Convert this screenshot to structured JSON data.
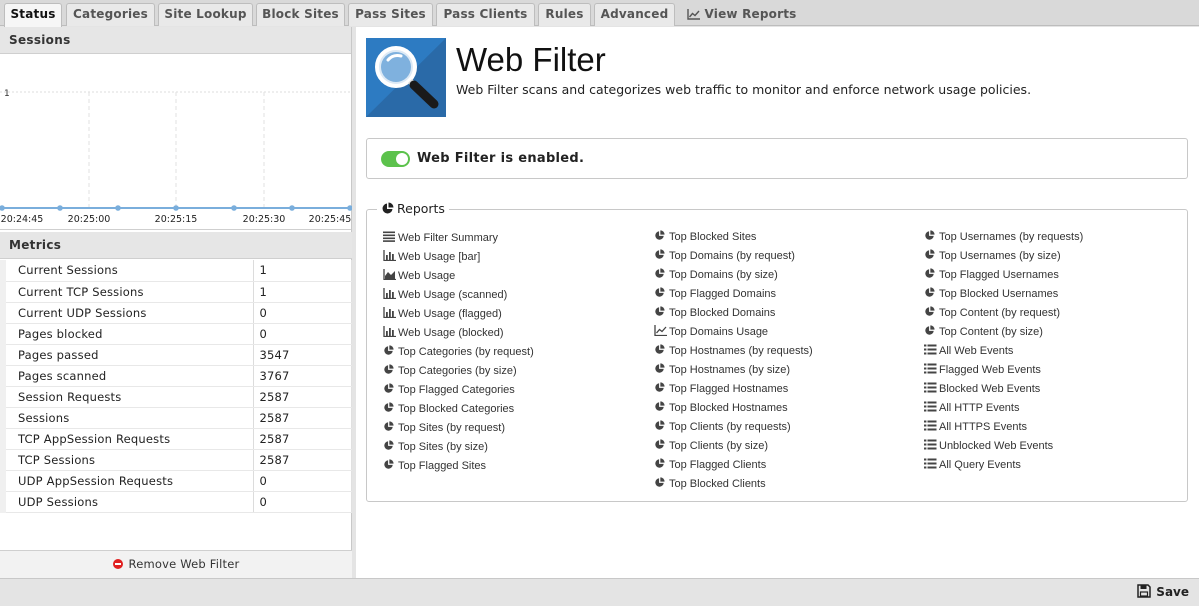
{
  "tabs": [
    {
      "label": "Status",
      "active": true
    },
    {
      "label": "Categories"
    },
    {
      "label": "Site Lookup"
    },
    {
      "label": "Block Sites"
    },
    {
      "label": "Pass Sites"
    },
    {
      "label": "Pass Clients"
    },
    {
      "label": "Rules"
    },
    {
      "label": "Advanced"
    },
    {
      "label": "View Reports",
      "icon": "line-chart-icon"
    }
  ],
  "sessions": {
    "title": "Sessions",
    "chart_data": {
      "type": "line",
      "x": [
        "20:24:45",
        "20:25:00",
        "20:25:15",
        "20:25:30",
        "20:25:45"
      ],
      "values": [
        0,
        0,
        0,
        0,
        0,
        0,
        0
      ],
      "ymax_label": "1",
      "ylim": [
        0,
        1
      ]
    }
  },
  "metrics": {
    "title": "Metrics",
    "rows": [
      {
        "name": "Current Sessions",
        "value": "1"
      },
      {
        "name": "Current TCP Sessions",
        "value": "1"
      },
      {
        "name": "Current UDP Sessions",
        "value": "0"
      },
      {
        "name": "Pages blocked",
        "value": "0"
      },
      {
        "name": "Pages passed",
        "value": "3547"
      },
      {
        "name": "Pages scanned",
        "value": "3767"
      },
      {
        "name": "Session Requests",
        "value": "2587"
      },
      {
        "name": "Sessions",
        "value": "2587"
      },
      {
        "name": "TCP AppSession Requests",
        "value": "2587"
      },
      {
        "name": "TCP Sessions",
        "value": "2587"
      },
      {
        "name": "UDP AppSession Requests",
        "value": "0"
      },
      {
        "name": "UDP Sessions",
        "value": "0"
      }
    ],
    "remove_label": "Remove Web Filter"
  },
  "app": {
    "title": "Web Filter",
    "description": "Web Filter scans and categorizes web traffic to monitor and enforce network usage policies.",
    "status_text": "Web Filter is enabled.",
    "enabled": true
  },
  "reports": {
    "legend": "Reports",
    "columns": [
      [
        {
          "label": "Web Filter Summary",
          "icon": "list-icon"
        },
        {
          "label": "Web Usage [bar]",
          "icon": "bar-chart-icon"
        },
        {
          "label": "Web Usage",
          "icon": "area-chart-icon"
        },
        {
          "label": "Web Usage (scanned)",
          "icon": "bar-chart-icon"
        },
        {
          "label": "Web Usage (flagged)",
          "icon": "bar-chart-icon"
        },
        {
          "label": "Web Usage (blocked)",
          "icon": "bar-chart-icon"
        },
        {
          "label": "Top Categories (by request)",
          "icon": "pie-chart-icon"
        },
        {
          "label": "Top Categories (by size)",
          "icon": "pie-chart-icon"
        },
        {
          "label": "Top Flagged Categories",
          "icon": "pie-chart-icon"
        },
        {
          "label": "Top Blocked Categories",
          "icon": "pie-chart-icon"
        },
        {
          "label": "Top Sites (by request)",
          "icon": "pie-chart-icon"
        },
        {
          "label": "Top Sites (by size)",
          "icon": "pie-chart-icon"
        },
        {
          "label": "Top Flagged Sites",
          "icon": "pie-chart-icon"
        }
      ],
      [
        {
          "label": "Top Blocked Sites",
          "icon": "pie-chart-icon"
        },
        {
          "label": "Top Domains (by request)",
          "icon": "pie-chart-icon"
        },
        {
          "label": "Top Domains (by size)",
          "icon": "pie-chart-icon"
        },
        {
          "label": "Top Flagged Domains",
          "icon": "pie-chart-icon"
        },
        {
          "label": "Top Blocked Domains",
          "icon": "pie-chart-icon"
        },
        {
          "label": "Top Domains Usage",
          "icon": "line-chart-icon"
        },
        {
          "label": "Top Hostnames (by requests)",
          "icon": "pie-chart-icon"
        },
        {
          "label": "Top Hostnames (by size)",
          "icon": "pie-chart-icon"
        },
        {
          "label": "Top Flagged Hostnames",
          "icon": "pie-chart-icon"
        },
        {
          "label": "Top Blocked Hostnames",
          "icon": "pie-chart-icon"
        },
        {
          "label": "Top Clients (by requests)",
          "icon": "pie-chart-icon"
        },
        {
          "label": "Top Clients (by size)",
          "icon": "pie-chart-icon"
        },
        {
          "label": "Top Flagged Clients",
          "icon": "pie-chart-icon"
        },
        {
          "label": "Top Blocked Clients",
          "icon": "pie-chart-icon"
        }
      ],
      [
        {
          "label": "Top Usernames (by requests)",
          "icon": "pie-chart-icon"
        },
        {
          "label": "Top Usernames (by size)",
          "icon": "pie-chart-icon"
        },
        {
          "label": "Top Flagged Usernames",
          "icon": "pie-chart-icon"
        },
        {
          "label": "Top Blocked Usernames",
          "icon": "pie-chart-icon"
        },
        {
          "label": "Top Content (by request)",
          "icon": "pie-chart-icon"
        },
        {
          "label": "Top Content (by size)",
          "icon": "pie-chart-icon"
        },
        {
          "label": "All Web Events",
          "icon": "list-ul-icon"
        },
        {
          "label": "Flagged Web Events",
          "icon": "list-ul-icon"
        },
        {
          "label": "Blocked Web Events",
          "icon": "list-ul-icon"
        },
        {
          "label": "All HTTP Events",
          "icon": "list-ul-icon"
        },
        {
          "label": "All HTTPS Events",
          "icon": "list-ul-icon"
        },
        {
          "label": "Unblocked Web Events",
          "icon": "list-ul-icon"
        },
        {
          "label": "All Query Events",
          "icon": "list-ul-icon"
        }
      ]
    ]
  },
  "footer": {
    "save_label": "Save"
  }
}
